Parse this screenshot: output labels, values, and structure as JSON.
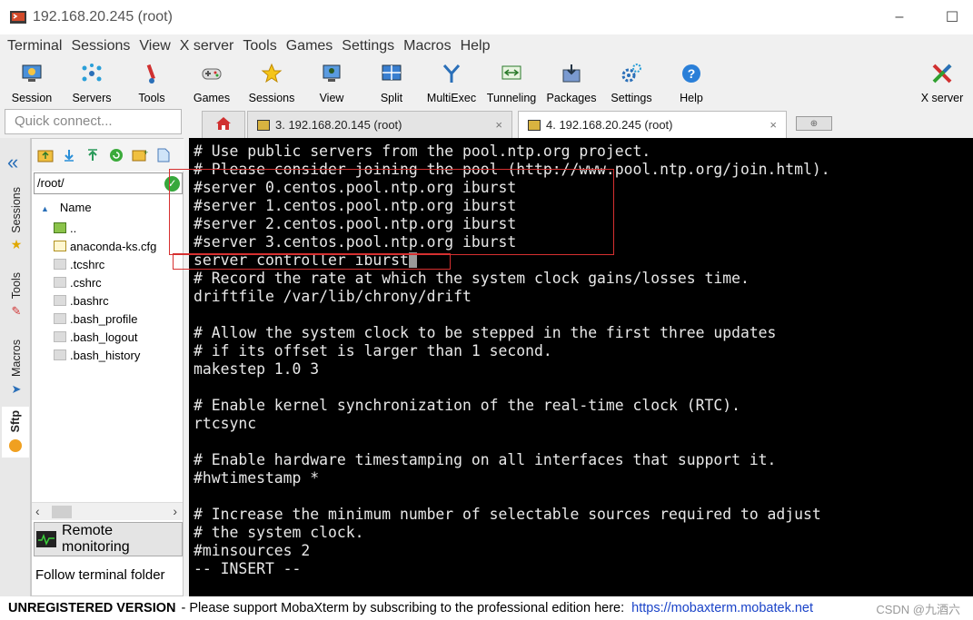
{
  "window": {
    "title": "192.168.20.245 (root)",
    "minimize": "–",
    "maximize": "☐"
  },
  "menu": [
    "Terminal",
    "Sessions",
    "View",
    "X server",
    "Tools",
    "Games",
    "Settings",
    "Macros",
    "Help"
  ],
  "toolbar": [
    "Session",
    "Servers",
    "Tools",
    "Games",
    "Sessions",
    "View",
    "Split",
    "MultiExec",
    "Tunneling",
    "Packages",
    "Settings",
    "Help"
  ],
  "toolbar_right": "X server",
  "quick_connect": {
    "placeholder": "Quick connect..."
  },
  "tabs": [
    {
      "label": "3. 192.168.20.145 (root)",
      "close": "×"
    },
    {
      "label": "4. 192.168.20.245 (root)",
      "close": "×"
    }
  ],
  "side_tabs": [
    "Sessions",
    "Tools",
    "Macros",
    "Sftp"
  ],
  "file_panel": {
    "path": "/root/",
    "column_name": "Name",
    "files": [
      "..",
      "anaconda-ks.cfg",
      ".tcshrc",
      ".cshrc",
      ".bashrc",
      ".bash_profile",
      ".bash_logout",
      ".bash_history"
    ],
    "remote_monitoring": "Remote monitoring",
    "follow_terminal_folder": "Follow terminal folder"
  },
  "terminal": {
    "lines": [
      "# Use public servers from the pool.ntp.org project.",
      "# Please consider joining the pool (http://www.pool.ntp.org/join.html).",
      "#server 0.centos.pool.ntp.org iburst",
      "#server 1.centos.pool.ntp.org iburst",
      "#server 2.centos.pool.ntp.org iburst",
      "#server 3.centos.pool.ntp.org iburst",
      "server controller iburst",
      "# Record the rate at which the system clock gains/losses time.",
      "driftfile /var/lib/chrony/drift",
      "",
      "# Allow the system clock to be stepped in the first three updates",
      "# if its offset is larger than 1 second.",
      "makestep 1.0 3",
      "",
      "# Enable kernel synchronization of the real-time clock (RTC).",
      "rtcsync",
      "",
      "# Enable hardware timestamping on all interfaces that support it.",
      "#hwtimestamp *",
      "",
      "# Increase the minimum number of selectable sources required to adjust",
      "# the system clock.",
      "#minsources 2",
      "-- INSERT --"
    ],
    "cursor_line": 6
  },
  "status": {
    "unregistered": "UNREGISTERED VERSION",
    "message": "-  Please support MobaXterm by subscribing to the professional edition here:",
    "link": "https://mobaxterm.mobatek.net",
    "watermark": "CSDN @九酒六"
  }
}
